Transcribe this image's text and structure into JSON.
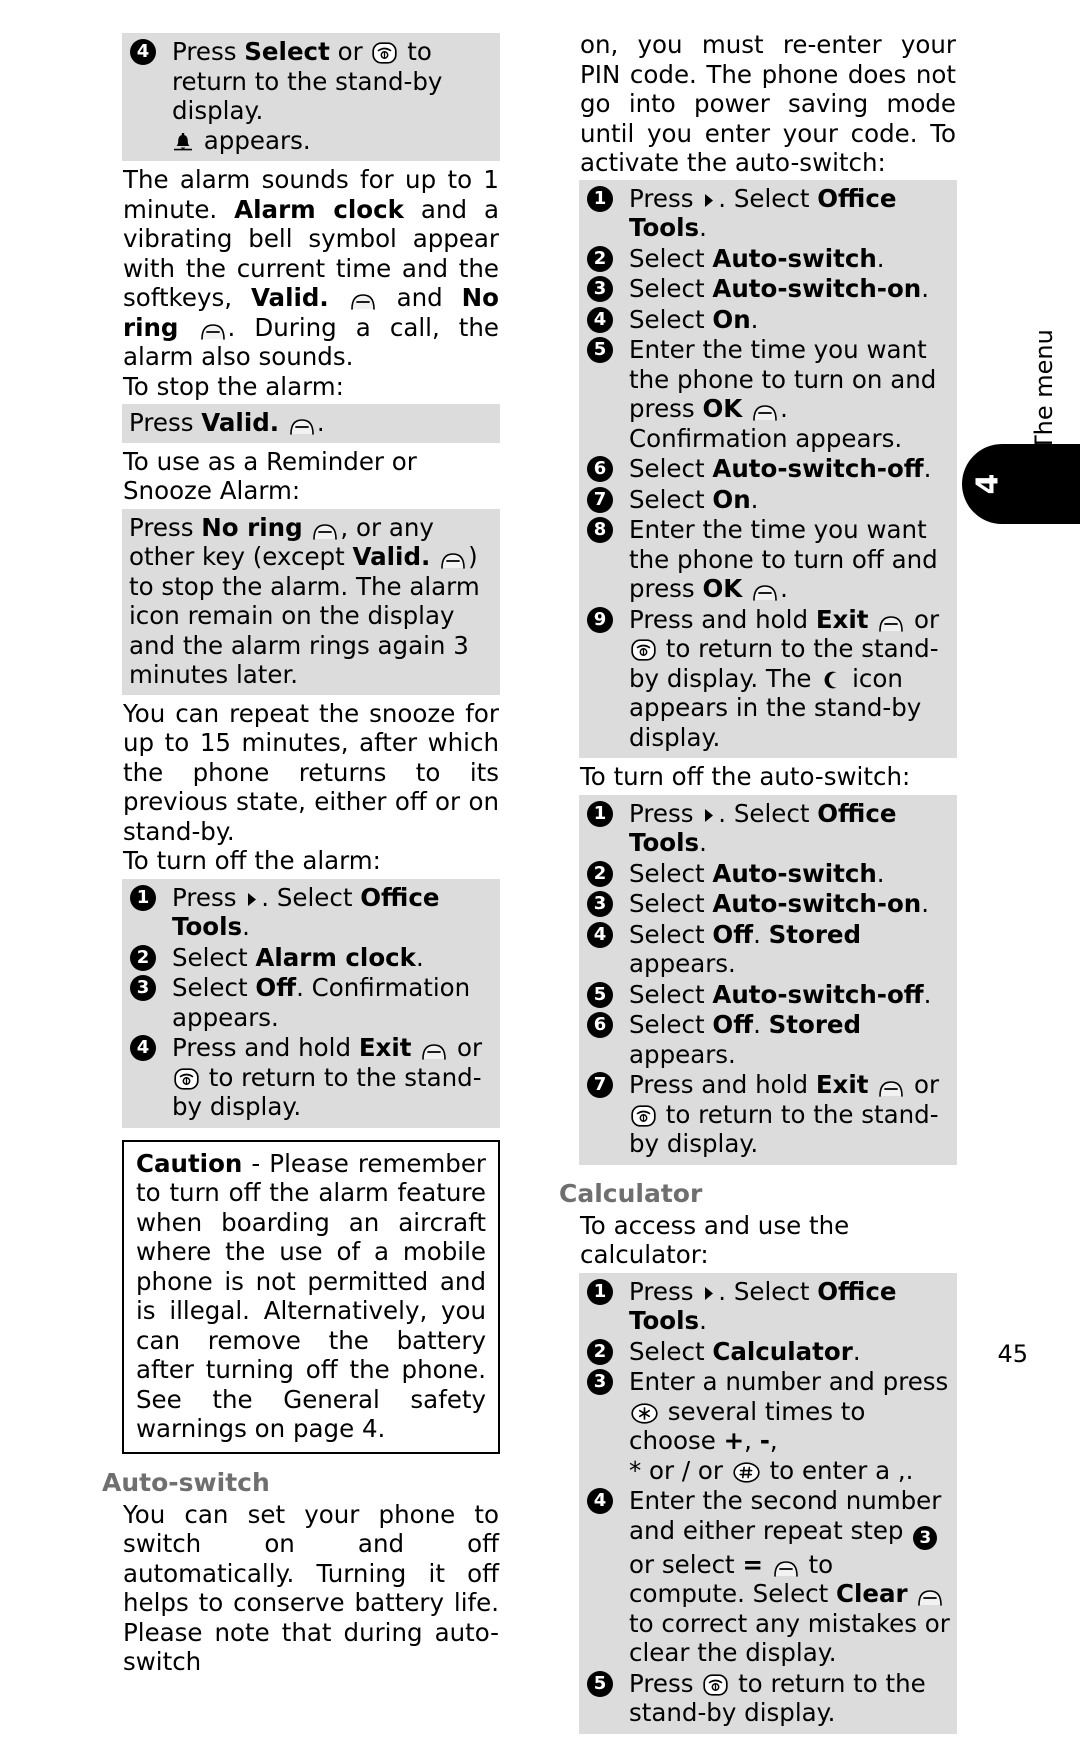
{
  "page": {
    "folio": "45",
    "tab_label": "The menu",
    "tab_number": "4"
  },
  "icons": {
    "softkey": "softkey-arch-icon",
    "endcall": "end-call-key-icon",
    "navarrow": "nav-right-arrow-icon",
    "bell": "alarm-bell-icon",
    "star": "star-key-icon",
    "hash": "hash-key-icon",
    "moon": "crescent-moon-icon"
  },
  "left_column": {
    "alarm_return_box": {
      "steps": [
        {
          "num": "4",
          "parts": [
            {
              "t": "Press "
            },
            {
              "t": "Select",
              "b": true
            },
            {
              "t": " or "
            },
            {
              "icon": "endcall"
            },
            {
              "t": " to return to the stand-by display."
            },
            {
              "br": true
            },
            {
              "icon": "bell"
            },
            {
              "t": " appears."
            }
          ]
        }
      ]
    },
    "alarm_sounds_para": [
      {
        "t": "The alarm sounds for up to 1 minute. "
      },
      {
        "t": "Alarm clock",
        "b": true
      },
      {
        "t": " and a vibrating bell symbol appear with the current time and the softkeys, "
      },
      {
        "t": "Valid.",
        "b": true
      },
      {
        "t": " "
      },
      {
        "icon": "softkey"
      },
      {
        "t": " and "
      },
      {
        "t": "No ring",
        "b": true
      },
      {
        "t": " "
      },
      {
        "icon": "softkey"
      },
      {
        "t": ". During a call, the alarm also sounds."
      }
    ],
    "to_stop_alarm_lead": "To stop the alarm:",
    "stop_alarm_box": [
      {
        "t": "Press "
      },
      {
        "t": "Valid.",
        "b": true
      },
      {
        "t": " "
      },
      {
        "icon": "softkey"
      },
      {
        "t": "."
      }
    ],
    "reminder_lead": "To use as a Reminder or Snooze Alarm:",
    "reminder_box": [
      {
        "t": "Press "
      },
      {
        "t": "No ring",
        "b": true
      },
      {
        "t": " "
      },
      {
        "icon": "softkey"
      },
      {
        "t": ", or any other key (except "
      },
      {
        "t": "Valid.",
        "b": true
      },
      {
        "t": " "
      },
      {
        "icon": "softkey"
      },
      {
        "t": ") to stop the alarm. The alarm icon remain on the display and the alarm rings again 3 minutes later."
      }
    ],
    "snooze_para": "You can repeat the snooze for up to 15 minutes, after which the phone returns to its previous state, either off or on stand-by.",
    "turn_off_alarm_lead": "To turn off the alarm:",
    "turn_off_alarm_steps": [
      {
        "num": "1",
        "parts": [
          {
            "t": "Press "
          },
          {
            "icon": "navarrow"
          },
          {
            "t": ". Select "
          },
          {
            "t": "Office Tools",
            "b": true
          },
          {
            "t": "."
          }
        ]
      },
      {
        "num": "2",
        "parts": [
          {
            "t": "Select "
          },
          {
            "t": "Alarm clock",
            "b": true
          },
          {
            "t": "."
          }
        ]
      },
      {
        "num": "3",
        "parts": [
          {
            "t": "Select "
          },
          {
            "t": "Off",
            "b": true
          },
          {
            "t": ". Confirmation appears."
          }
        ]
      },
      {
        "num": "4",
        "parts": [
          {
            "t": "Press and hold "
          },
          {
            "t": "Exit",
            "b": true
          },
          {
            "t": " "
          },
          {
            "icon": "softkey"
          },
          {
            "t": " or "
          },
          {
            "icon": "endcall"
          },
          {
            "t": " to return to the stand-by display."
          }
        ]
      }
    ],
    "caution_box": [
      {
        "t": "Caution",
        "b": true
      },
      {
        "t": " - Please remember to turn off the alarm feature when boarding an aircraft where the use of a mobile phone is not permitted and is illegal. Alternatively, you can remove the battery after turning off the phone. See the General safety warnings on page 4."
      }
    ],
    "auto_switch_heading": "Auto-switch",
    "auto_switch_para": "You can set your phone to switch on and off automatically. Turning it off helps to conserve battery life. Please note that during auto-switch"
  },
  "right_column": {
    "continuation_para": "on, you must re-enter your PIN code. The phone does not go into power saving mode until you enter your code. To activate the auto-switch:",
    "activate_steps": [
      {
        "num": "1",
        "parts": [
          {
            "t": "Press "
          },
          {
            "icon": "navarrow"
          },
          {
            "t": ". Select "
          },
          {
            "t": "Office Tools",
            "b": true
          },
          {
            "t": "."
          }
        ]
      },
      {
        "num": "2",
        "parts": [
          {
            "t": "Select "
          },
          {
            "t": "Auto-switch",
            "b": true
          },
          {
            "t": "."
          }
        ]
      },
      {
        "num": "3",
        "parts": [
          {
            "t": "Select "
          },
          {
            "t": "Auto-switch-on",
            "b": true
          },
          {
            "t": "."
          }
        ]
      },
      {
        "num": "4",
        "parts": [
          {
            "t": "Select "
          },
          {
            "t": "On",
            "b": true
          },
          {
            "t": "."
          }
        ]
      },
      {
        "num": "5",
        "parts": [
          {
            "t": "Enter the time you want the phone to turn on and"
          },
          {
            "br": true
          },
          {
            "t": "press "
          },
          {
            "t": "OK",
            "b": true
          },
          {
            "t": " "
          },
          {
            "icon": "softkey"
          },
          {
            "t": ". Confirmation appears."
          }
        ]
      },
      {
        "num": "6",
        "parts": [
          {
            "t": "Select "
          },
          {
            "t": "Auto-switch-off",
            "b": true
          },
          {
            "t": "."
          }
        ]
      },
      {
        "num": "7",
        "parts": [
          {
            "t": "Select "
          },
          {
            "t": "On",
            "b": true
          },
          {
            "t": "."
          }
        ]
      },
      {
        "num": "8",
        "parts": [
          {
            "t": "Enter the time you want the phone to turn off and"
          },
          {
            "br": true
          },
          {
            "t": "press "
          },
          {
            "t": "OK",
            "b": true
          },
          {
            "t": " "
          },
          {
            "icon": "softkey"
          },
          {
            "t": "."
          }
        ]
      },
      {
        "num": "9",
        "parts": [
          {
            "t": "Press and hold "
          },
          {
            "t": "Exit",
            "b": true
          },
          {
            "t": " "
          },
          {
            "icon": "softkey"
          },
          {
            "t": " or "
          },
          {
            "icon": "endcall"
          },
          {
            "t": " to return to the stand-by display. The "
          },
          {
            "icon": "moon"
          },
          {
            "t": " icon appears in the stand-by display."
          }
        ]
      }
    ],
    "turn_off_lead": "To turn off the auto-switch:",
    "turn_off_steps": [
      {
        "num": "1",
        "parts": [
          {
            "t": "Press "
          },
          {
            "icon": "navarrow"
          },
          {
            "t": ". Select "
          },
          {
            "t": "Office Tools",
            "b": true
          },
          {
            "t": "."
          }
        ]
      },
      {
        "num": "2",
        "parts": [
          {
            "t": "Select "
          },
          {
            "t": "Auto-switch",
            "b": true
          },
          {
            "t": "."
          }
        ]
      },
      {
        "num": "3",
        "parts": [
          {
            "t": "Select "
          },
          {
            "t": "Auto-switch-on",
            "b": true
          },
          {
            "t": "."
          }
        ]
      },
      {
        "num": "4",
        "parts": [
          {
            "t": "Select "
          },
          {
            "t": "Off",
            "b": true
          },
          {
            "t": ". "
          },
          {
            "t": "Stored",
            "b": true
          },
          {
            "t": " appears."
          }
        ]
      },
      {
        "num": "5",
        "parts": [
          {
            "t": "Select "
          },
          {
            "t": "Auto-switch-off",
            "b": true
          },
          {
            "t": "."
          }
        ]
      },
      {
        "num": "6",
        "parts": [
          {
            "t": "Select "
          },
          {
            "t": "Off",
            "b": true
          },
          {
            "t": ". "
          },
          {
            "t": "Stored",
            "b": true
          },
          {
            "t": " appears."
          }
        ]
      },
      {
        "num": "7",
        "parts": [
          {
            "t": "Press and hold "
          },
          {
            "t": "Exit",
            "b": true
          },
          {
            "t": " "
          },
          {
            "icon": "softkey"
          },
          {
            "t": " or "
          },
          {
            "icon": "endcall"
          },
          {
            "t": " to return to the stand-by display."
          }
        ]
      }
    ],
    "calculator_heading": "Calculator",
    "calculator_lead": "To access and use the calculator:",
    "calculator_steps": [
      {
        "num": "1",
        "parts": [
          {
            "t": "Press "
          },
          {
            "icon": "navarrow"
          },
          {
            "t": ". Select "
          },
          {
            "t": "Office Tools",
            "b": true
          },
          {
            "t": "."
          }
        ]
      },
      {
        "num": "2",
        "parts": [
          {
            "t": "Select "
          },
          {
            "t": "Calculator",
            "b": true
          },
          {
            "t": "."
          }
        ]
      },
      {
        "num": "3",
        "parts": [
          {
            "t": "Enter a number and press "
          },
          {
            "icon": "star"
          },
          {
            "t": " several times to choose "
          },
          {
            "t": "+",
            "b": true
          },
          {
            "t": ", "
          },
          {
            "t": "-",
            "b": true
          },
          {
            "t": ","
          },
          {
            "br": true
          },
          {
            "t": "* or / or "
          },
          {
            "icon": "hash"
          },
          {
            "t": " to enter a ,."
          }
        ]
      },
      {
        "num": "4",
        "parts": [
          {
            "t": "Enter the second number and either repeat step "
          },
          {
            "bullet": "3"
          },
          {
            "t": " or select "
          },
          {
            "t": "=",
            "b": true
          },
          {
            "t": " "
          },
          {
            "icon": "softkey"
          },
          {
            "t": " to compute. Select "
          },
          {
            "t": "Clear",
            "b": true
          },
          {
            "t": " "
          },
          {
            "icon": "softkey"
          },
          {
            "t": " to correct any mistakes or clear the display."
          }
        ]
      },
      {
        "num": "5",
        "parts": [
          {
            "t": "Press "
          },
          {
            "icon": "endcall"
          },
          {
            "t": " to return to the stand-by display."
          }
        ]
      }
    ]
  }
}
